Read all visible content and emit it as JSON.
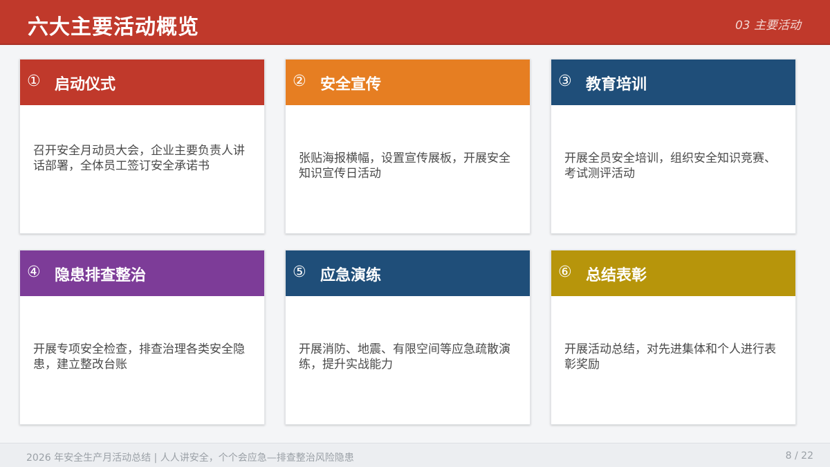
{
  "header": {
    "title": "六大主要活动概览",
    "section": "03  主要活动"
  },
  "colors": {
    "header_red": "#c0392b",
    "card_red": "#c0392b",
    "card_orange": "#e67e22",
    "card_navy": "#1f4e79",
    "card_purple": "#7d3c98",
    "card_gold": "#b7950b"
  },
  "cards": [
    {
      "num": "①",
      "title": "启动仪式",
      "text": "召开安全月动员大会，企业主要负责人讲话部署，全体员工签订安全承诺书"
    },
    {
      "num": "②",
      "title": "安全宣传",
      "text": "张贴海报横幅，设置宣传展板，开展安全知识宣传日活动"
    },
    {
      "num": "③",
      "title": "教育培训",
      "text": "开展全员安全培训，组织安全知识竞赛、考试测评活动"
    },
    {
      "num": "④",
      "title": "隐患排查整治",
      "text": "开展专项安全检查，排查治理各类安全隐患，建立整改台账"
    },
    {
      "num": "⑤",
      "title": "应急演练",
      "text": "开展消防、地震、有限空间等应急疏散演练，提升实战能力"
    },
    {
      "num": "⑥",
      "title": "总结表彰",
      "text": "开展活动总结，对先进集体和个人进行表彰奖励"
    }
  ],
  "footer": {
    "text": "2026 年安全生产月活动总结  |  人人讲安全，个个会应急—排查整治风险隐患",
    "page": "8 / 22"
  }
}
